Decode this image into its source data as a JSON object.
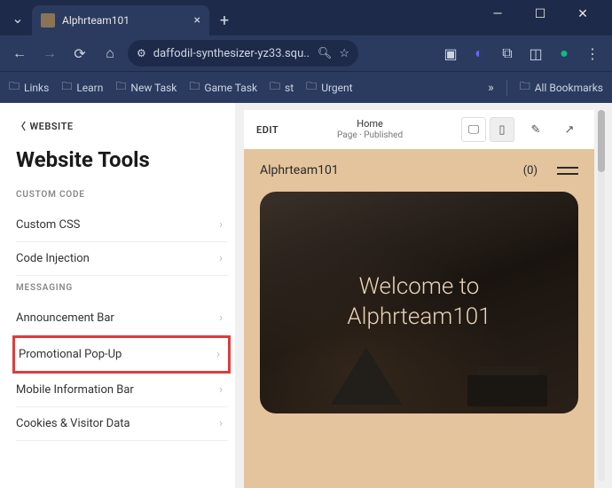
{
  "browser": {
    "tab_title": "Alphrteam101",
    "url": "daffodil-synthesizer-yz33.squ...",
    "bookmarks": [
      "Links",
      "Learn",
      "New Task",
      "Game Task",
      "st",
      "Urgent"
    ],
    "all_bookmarks_label": "All Bookmarks"
  },
  "sidebar": {
    "back_label": "WEBSITE",
    "title": "Website Tools",
    "sections": [
      {
        "label": "CUSTOM CODE",
        "items": [
          "Custom CSS",
          "Code Injection"
        ]
      },
      {
        "label": "MESSAGING",
        "items": [
          "Announcement Bar",
          "Promotional Pop-Up",
          "Mobile Information Bar",
          "Cookies & Visitor Data"
        ]
      }
    ]
  },
  "preview": {
    "edit_label": "EDIT",
    "page_title": "Home",
    "page_status": "Page · Published",
    "site_name": "Alphrteam101",
    "cart_count": "(0)",
    "hero_line1": "Welcome to",
    "hero_line2": "Alphrteam101"
  }
}
